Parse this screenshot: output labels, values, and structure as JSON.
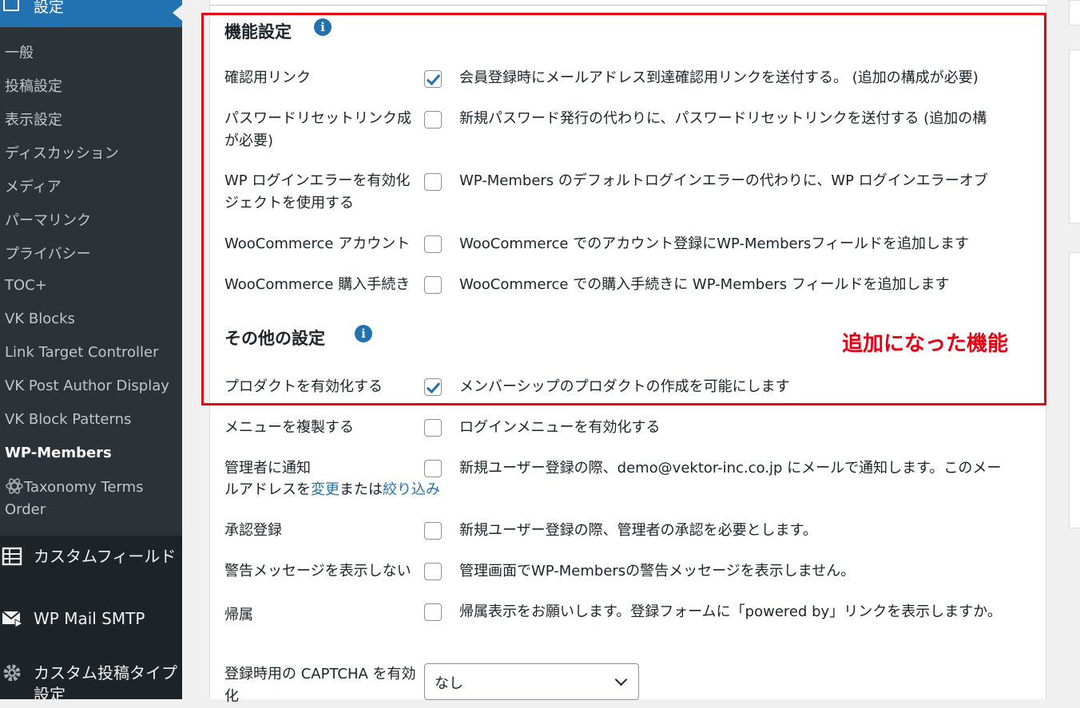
{
  "sidebar": {
    "settings_label": "設定",
    "submenu": [
      "一般",
      "投稿設定",
      "表示設定",
      "ディスカッション",
      "メディア",
      "パーマリンク",
      "プライバシー",
      "TOC+",
      "VK Blocks",
      "Link Target Controller",
      "VK Post Author Display",
      "VK Block Patterns",
      "WP-Members"
    ],
    "taxonomy_item": "Taxonomy Terms Order",
    "menus": [
      {
        "label": "カスタムフィールド",
        "icon": "table-icon"
      },
      {
        "label": "WP Mail SMTP",
        "icon": "mail-icon"
      },
      {
        "label": "カスタム投稿タイプ設定",
        "icon": "gear-icon"
      }
    ]
  },
  "sections": {
    "features_title": "機能設定",
    "other_title": "その他の設定"
  },
  "features": [
    {
      "label": "確認用リンク",
      "checked": true,
      "desc": "会員登録時にメールアドレス到達確認用リンクを送付する。 (追加の構成が必要)"
    },
    {
      "label": "パスワードリセットリンク成が必要)",
      "checked": false,
      "desc": "新規パスワード発行の代わりに、パスワードリセットリンクを送付する (追加の構"
    },
    {
      "label": "WP ログインエラーを有効化ジェクトを使用する",
      "checked": false,
      "desc": "WP-Members のデフォルトログインエラーの代わりに、WP ログインエラーオブ"
    },
    {
      "label": "WooCommerce アカウント",
      "checked": false,
      "desc": "WooCommerce でのアカウント登録にWP-Membersフィールドを追加します"
    },
    {
      "label": "WooCommerce 購入手続き",
      "checked": false,
      "desc": "WooCommerce での購入手続きに WP-Members フィールドを追加します"
    }
  ],
  "other": [
    {
      "label": "プロダクトを有効化する",
      "checked": true,
      "desc": "メンバーシップのプロダクトの作成を可能にします"
    },
    {
      "label": "メニューを複製する",
      "checked": false,
      "desc": "ログインメニューを有効化する"
    },
    {
      "label": "管理者に通知",
      "checked": false,
      "desc": "新規ユーザー登録の際、demo@vektor-inc.co.jp にメールで通知します。このメー",
      "desc2": "ルアドレスを",
      "link1": "変更",
      "mid": "または",
      "link2": "絞り込み"
    },
    {
      "label": "承認登録",
      "checked": false,
      "desc": "新規ユーザー登録の際、管理者の承認を必要とします。"
    },
    {
      "label": "警告メッセージを表示しない",
      "checked": false,
      "desc": "管理画面でWP-Membersの警告メッセージを表示しません。"
    },
    {
      "label": "帰属",
      "checked": false,
      "desc": "帰属表示をお願いします。登録フォームに「powered by」リンクを表示しますか。"
    },
    {
      "label": "登録時用の CAPTCHA を有効化"
    }
  ],
  "captcha_select": {
    "value": "なし"
  },
  "annotation": {
    "text": "追加になった機能",
    "color": "#e60012"
  },
  "colors": {
    "sidebar": "#2c3338",
    "active": "#2271b1",
    "accent": "#2271b1"
  }
}
